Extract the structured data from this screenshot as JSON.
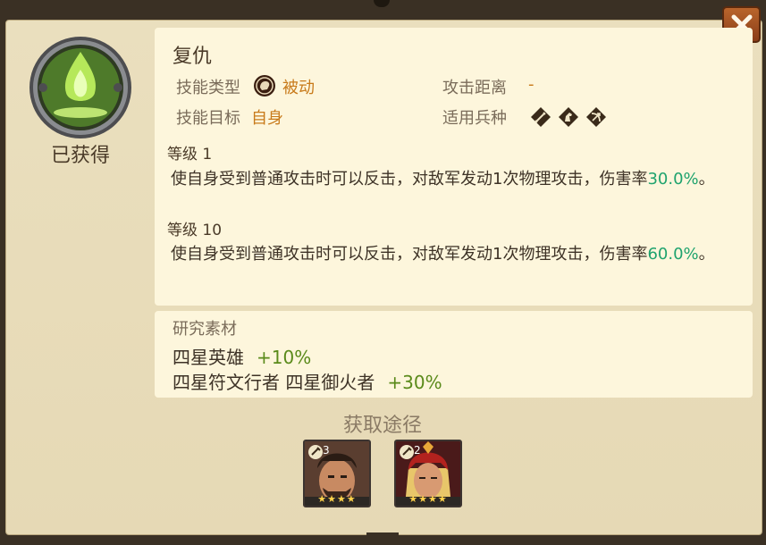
{
  "skill": {
    "name": "复仇",
    "status": "已获得",
    "icon": "green-flame-skill-icon",
    "type_label": "技能类型",
    "type_value": "被动",
    "type_icon": "passive-fist-icon",
    "target_label": "技能目标",
    "target_value": "自身",
    "range_label": "攻击距离",
    "range_value": "-",
    "troop_label": "适用兵种",
    "troop_icons": [
      "infantry-sword-icon",
      "cavalry-horse-icon",
      "archer-bow-icon"
    ]
  },
  "levels": [
    {
      "label": "等级 1",
      "desc_prefix": "使自身受到普通攻击时可以反击，对敌军发动1次物理攻击，伤害率",
      "value": "30.0%",
      "desc_suffix": "。"
    },
    {
      "label": "等级 10",
      "desc_prefix": "使自身受到普通攻击时可以反击，对敌军发动1次物理攻击，伤害率",
      "value": "60.0%",
      "desc_suffix": "。"
    }
  ],
  "materials": {
    "title": "研究素材",
    "rows": [
      {
        "name": "四星英雄",
        "bonus": "+10%"
      },
      {
        "name": "四星符文行者 四星御火者",
        "bonus": "+30%"
      }
    ]
  },
  "sources": {
    "title": "获取途径",
    "heroes": [
      {
        "icon": "hero-portrait-bearded-warrior",
        "level": "3",
        "stars": 4
      },
      {
        "icon": "hero-portrait-red-helmet-warrior",
        "level": "2",
        "stars": 4
      }
    ]
  },
  "colors": {
    "accent_orange": "#c87a1a",
    "value_green": "#1fa36e",
    "bonus_green": "#5a8a1a"
  }
}
